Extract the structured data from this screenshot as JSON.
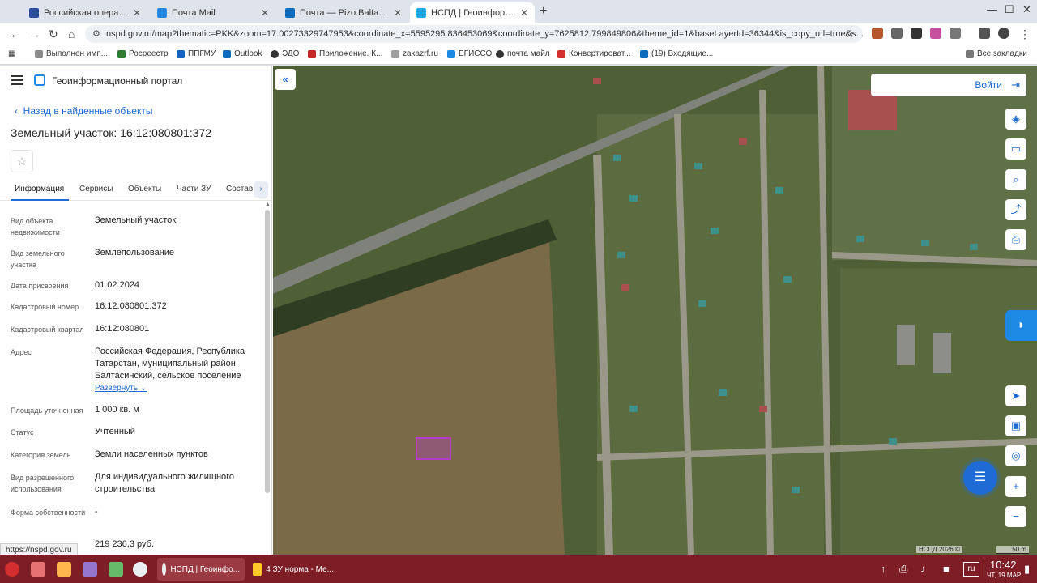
{
  "browser": {
    "tabs": [
      {
        "title": "Российская операционн",
        "favicon_color": "#2b4d9c"
      },
      {
        "title": "Почта Mail",
        "favicon_color": "#1e88e5"
      },
      {
        "title": "Почта — Pizo.Baltasi@tat",
        "favicon_color": "#0f6cbd"
      },
      {
        "title": "НСПД | Геоинформацион",
        "favicon_color": "#1ea7e5"
      }
    ],
    "url": "nspd.gov.ru/map?thematic=PKK&zoom=17.00273329747953&coordinate_x=5595295.836453069&coordinate_y=7625812.799849806&theme_id=1&baseLayerId=36344&is_copy_url=true&s...",
    "bookmarks": [
      "Выполнен имп...",
      "Росреестр",
      "ППГМУ",
      "Outlook",
      "ЭДО",
      "Приложение. К...",
      "zakazrf.ru",
      "ЕГИССО",
      "почта майл",
      "Конвертироват...",
      "(19) Входящие..."
    ],
    "all_bookmarks": "Все закладки"
  },
  "panel": {
    "portal_title": "Геоинформационный портал",
    "back_link": "Назад в найденные объекты",
    "object_title": "Земельный участок: 16:12:080801:372",
    "tabs": [
      "Информация",
      "Сервисы",
      "Объекты",
      "Части ЗУ",
      "Состав"
    ],
    "fields": [
      {
        "label": "Вид объекта недвижимости",
        "value": "Земельный участок"
      },
      {
        "label": "Вид земельного участка",
        "value": "Землепользование"
      },
      {
        "label": "Дата присвоения",
        "value": "01.02.2024"
      },
      {
        "label": "Кадастровый номер",
        "value": "16:12:080801:372"
      },
      {
        "label": "Кадастровый квартал",
        "value": "16:12:080801"
      },
      {
        "label": "Адрес",
        "value": "Российская Федерация, Республика Татарстан, муниципальный район Балтасинский, сельское поселение"
      },
      {
        "label": "Площадь уточненная",
        "value": "1 000 кв. м"
      },
      {
        "label": "Статус",
        "value": "Учтенный"
      },
      {
        "label": "Категория земель",
        "value": "Земли населенных пунктов"
      },
      {
        "label": "Вид разрешенного использования",
        "value": "Для индивидуального жилищного строительства"
      },
      {
        "label": "Форма собственности",
        "value": "-"
      },
      {
        "label": "",
        "value": "219 236,3 руб."
      }
    ],
    "expand_label": "Развернуть",
    "status_url": "https://nspd.gov.ru"
  },
  "map": {
    "login_label": "Войти",
    "attribution": "НСПД 2026 ©",
    "scale": "50 m"
  },
  "taskbar": {
    "tasks": [
      "НСПД | Геоинфо...",
      "4 ЗУ норма - Ме..."
    ],
    "lang": "ru",
    "time": "10:42",
    "date": "ЧТ, 19 МАР"
  }
}
